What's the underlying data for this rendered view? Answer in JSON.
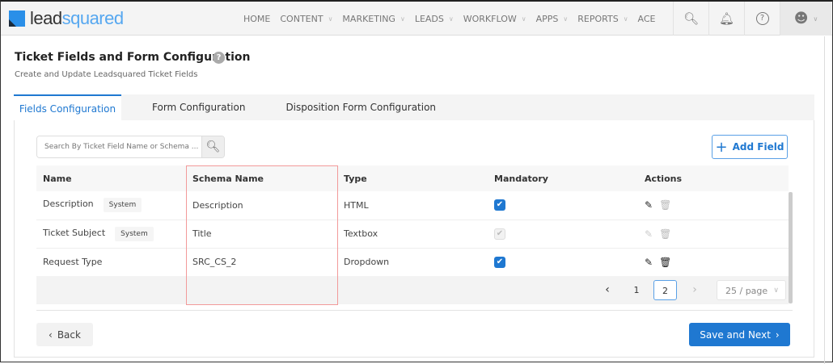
{
  "header": {
    "logo_lead": "lead",
    "logo_squared": "squared",
    "nav": [
      {
        "label": "HOME",
        "dropdown": false
      },
      {
        "label": "CONTENT",
        "dropdown": true
      },
      {
        "label": "MARKETING",
        "dropdown": true
      },
      {
        "label": "LEADS",
        "dropdown": true
      },
      {
        "label": "WORKFLOW",
        "dropdown": true
      },
      {
        "label": "APPS",
        "dropdown": true
      },
      {
        "label": "REPORTS",
        "dropdown": true
      },
      {
        "label": "ACE",
        "dropdown": false
      }
    ]
  },
  "page": {
    "title": "Ticket Fields and Form Configuration",
    "subtitle": "Create and Update Leadsquared Ticket Fields"
  },
  "tabs": [
    "Fields Configuration",
    "Form Configuration",
    "Disposition Form Configuration"
  ],
  "search": {
    "placeholder": "Search By Ticket Field Name or Schema ..."
  },
  "add_field": "Add Field",
  "table": {
    "headers": [
      "Name",
      "Schema Name",
      "Type",
      "Mandatory",
      "Actions"
    ],
    "rows": [
      {
        "name": "Description",
        "badge": "System",
        "schema": "Description",
        "type": "HTML",
        "mandatory": true,
        "mandatory_disabled": false,
        "edit_enabled": true,
        "delete_enabled": false
      },
      {
        "name": "Ticket Subject",
        "badge": "System",
        "schema": "Title",
        "type": "Textbox",
        "mandatory": true,
        "mandatory_disabled": true,
        "edit_enabled": false,
        "delete_enabled": false
      },
      {
        "name": "Request Type",
        "badge": null,
        "schema": "SRC_CS_2",
        "type": "Dropdown",
        "mandatory": true,
        "mandatory_disabled": false,
        "edit_enabled": true,
        "delete_enabled": true
      }
    ]
  },
  "pagination": {
    "pages": [
      "1",
      "2"
    ],
    "current": "2",
    "page_size": "25 / page"
  },
  "footer": {
    "back": "Back",
    "save": "Save and Next"
  },
  "colors": {
    "accent": "#1f78d1",
    "highlight": "#f29a9a"
  }
}
